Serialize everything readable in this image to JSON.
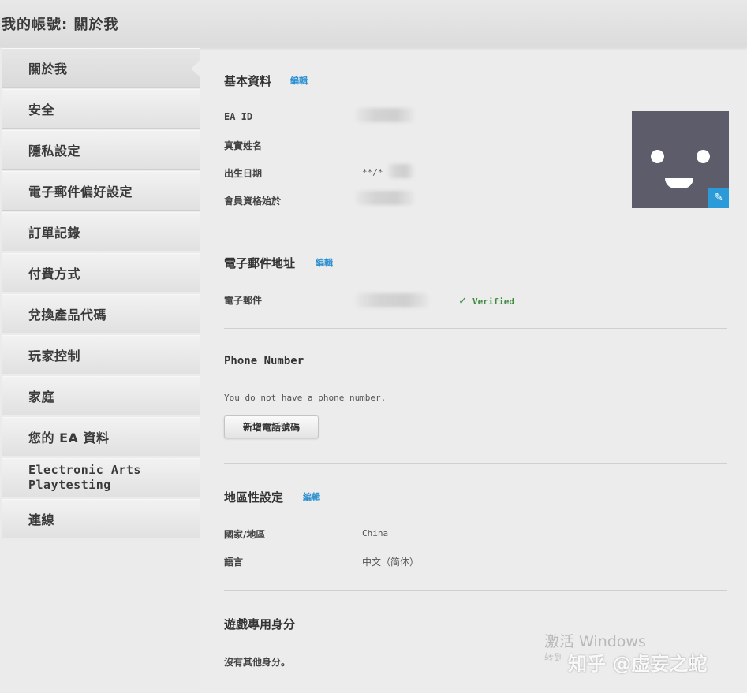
{
  "header": {
    "title": "我的帳號: 關於我"
  },
  "sidebar": {
    "items": [
      {
        "label": "關於我",
        "active": true
      },
      {
        "label": "安全"
      },
      {
        "label": "隱私設定"
      },
      {
        "label": "電子郵件偏好設定"
      },
      {
        "label": "訂單記錄"
      },
      {
        "label": "付費方式"
      },
      {
        "label": "兌換產品代碼"
      },
      {
        "label": "玩家控制"
      },
      {
        "label": "家庭"
      },
      {
        "label": "您的 EA 資料"
      },
      {
        "label": "Electronic Arts\nPlaytesting"
      },
      {
        "label": "連線"
      }
    ]
  },
  "basic_info": {
    "title": "基本資料",
    "edit_label": "編輯",
    "fields": [
      {
        "label": "EA ID",
        "value": ""
      },
      {
        "label": "真實姓名",
        "value": ""
      },
      {
        "label": "出生日期",
        "value": "**/*"
      },
      {
        "label": "會員資格始於",
        "value": ""
      }
    ],
    "avatar_icon": "smiley-avatar",
    "avatar_edit_icon": "pencil-icon"
  },
  "email": {
    "title": "電子郵件地址",
    "edit_label": "編輯",
    "field_label": "電子郵件",
    "status": "Verified",
    "status_color": "#3f8a3f"
  },
  "phone": {
    "title": "Phone Number",
    "note": "You do not have a phone number.",
    "add_button": "新增電話號碼"
  },
  "region": {
    "title": "地區性設定",
    "edit_label": "編輯",
    "fields": [
      {
        "label": "國家/地區",
        "value": "China"
      },
      {
        "label": "語言",
        "value": "中文（简体）"
      }
    ]
  },
  "game_identity": {
    "title": "遊戲專用身分",
    "note": "沒有其他身分。"
  },
  "overlay": {
    "windows_activate": "激活 Windows",
    "windows_hint": "转到",
    "zhihu_watermark": "知乎 @虚妄之蛇"
  },
  "colors": {
    "link": "#2a8fd0",
    "avatar_bg": "#5d5c6b",
    "avatar_badge": "#2a9ad8"
  }
}
